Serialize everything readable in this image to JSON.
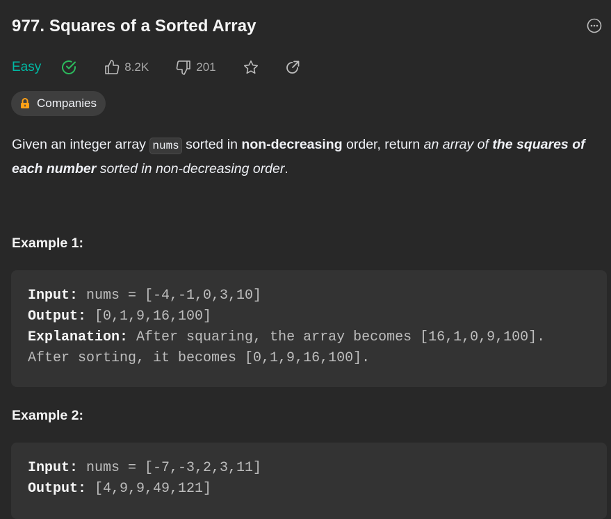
{
  "problem": {
    "title": "977. Squares of a Sorted Array",
    "difficulty": "Easy",
    "likes": "8.2K",
    "dislikes": "201",
    "companies_label": "Companies"
  },
  "description": {
    "p1": "Given an integer array ",
    "code1": "nums",
    "p2": " sorted in ",
    "b1": "non-decreasing",
    "p3": " order, return ",
    "i1": "an array of ",
    "bi1": "the squares of each number",
    "i2": " sorted in non-decreasing order",
    "p4": "."
  },
  "examples": [
    {
      "title": "Example 1:",
      "input_label": "Input:",
      "input_value": " nums = [-4,-1,0,3,10]",
      "output_label": "Output:",
      "output_value": " [0,1,9,16,100]",
      "explanation_label": "Explanation:",
      "explanation_line1": " After squaring, the array becomes [16,1,0,9,100].",
      "explanation_line2": "After sorting, it becomes [0,1,9,16,100]."
    },
    {
      "title": "Example 2:",
      "input_label": "Input:",
      "input_value": " nums = [-7,-3,2,3,11]",
      "output_label": "Output:",
      "output_value": " [4,9,9,49,121]"
    }
  ],
  "colors": {
    "background": "#282828",
    "easy": "#00b8a3",
    "solved": "#2cbb5d",
    "lock": "#ffa116",
    "muted": "#a8a8a8"
  },
  "icons": [
    "more-options-icon",
    "solved-check-icon",
    "thumbs-up-icon",
    "thumbs-down-icon",
    "star-icon",
    "share-icon",
    "lock-icon"
  ]
}
